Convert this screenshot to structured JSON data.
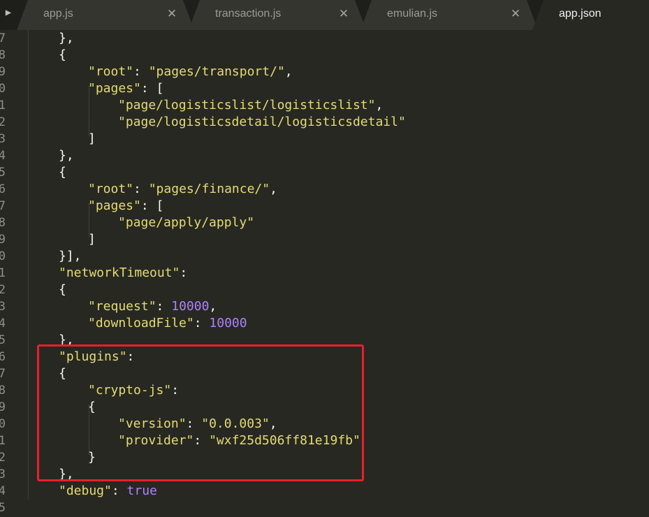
{
  "tabs": [
    {
      "label": "app.js",
      "active": false
    },
    {
      "label": "transaction.js",
      "active": false
    },
    {
      "label": "emulian.js",
      "active": false
    },
    {
      "label": "app.json",
      "active": true
    }
  ],
  "tab_close_glyph": "✕",
  "gutter_numbers": [
    "7",
    "8",
    "9",
    "0",
    "1",
    "2",
    "3",
    "4",
    "5",
    "6",
    "7",
    "8",
    "9",
    "0",
    "1",
    "2",
    "3",
    "4",
    "5",
    "6",
    "7",
    "8",
    "9",
    "0",
    "1",
    "2",
    "3",
    "4",
    "5"
  ],
  "code_lines": [
    [
      {
        "t": "},",
        "k": "punct"
      }
    ],
    [
      {
        "t": "{",
        "k": "punct"
      }
    ],
    [
      {
        "t": "\"root\"",
        "k": "key"
      },
      {
        "t": ": ",
        "k": "punct"
      },
      {
        "t": "\"pages/transport/\"",
        "k": "str"
      },
      {
        "t": ",",
        "k": "punct"
      }
    ],
    [
      {
        "t": "\"pages\"",
        "k": "key"
      },
      {
        "t": ": [",
        "k": "punct"
      }
    ],
    [
      {
        "t": "\"page/logisticslist/logisticslist\"",
        "k": "str"
      },
      {
        "t": ",",
        "k": "punct"
      }
    ],
    [
      {
        "t": "\"page/logisticsdetail/logisticsdetail\"",
        "k": "str"
      }
    ],
    [
      {
        "t": "]",
        "k": "punct"
      }
    ],
    [
      {
        "t": "},",
        "k": "punct"
      }
    ],
    [
      {
        "t": "{",
        "k": "punct"
      }
    ],
    [
      {
        "t": "\"root\"",
        "k": "key"
      },
      {
        "t": ": ",
        "k": "punct"
      },
      {
        "t": "\"pages/finance/\"",
        "k": "str"
      },
      {
        "t": ",",
        "k": "punct"
      }
    ],
    [
      {
        "t": "\"pages\"",
        "k": "key"
      },
      {
        "t": ": [",
        "k": "punct"
      }
    ],
    [
      {
        "t": "\"page/apply/apply\"",
        "k": "str"
      }
    ],
    [
      {
        "t": "]",
        "k": "punct"
      }
    ],
    [
      {
        "t": "}],",
        "k": "punct"
      }
    ],
    [
      {
        "t": "\"networkTimeout\"",
        "k": "key"
      },
      {
        "t": ":",
        "k": "punct"
      }
    ],
    [
      {
        "t": "{",
        "k": "punct"
      }
    ],
    [
      {
        "t": "\"request\"",
        "k": "key"
      },
      {
        "t": ": ",
        "k": "punct"
      },
      {
        "t": "10000",
        "k": "num"
      },
      {
        "t": ",",
        "k": "punct"
      }
    ],
    [
      {
        "t": "\"downloadFile\"",
        "k": "key"
      },
      {
        "t": ": ",
        "k": "punct"
      },
      {
        "t": "10000",
        "k": "num"
      }
    ],
    [
      {
        "t": "},",
        "k": "punct"
      }
    ],
    [
      {
        "t": "\"plugins\"",
        "k": "key"
      },
      {
        "t": ":",
        "k": "punct"
      }
    ],
    [
      {
        "t": "{",
        "k": "punct"
      }
    ],
    [
      {
        "t": "\"crypto-js\"",
        "k": "key"
      },
      {
        "t": ":",
        "k": "punct"
      }
    ],
    [
      {
        "t": "{",
        "k": "punct"
      }
    ],
    [
      {
        "t": "\"version\"",
        "k": "key"
      },
      {
        "t": ": ",
        "k": "punct"
      },
      {
        "t": "\"0.0.003\"",
        "k": "str"
      },
      {
        "t": ",",
        "k": "punct"
      }
    ],
    [
      {
        "t": "\"provider\"",
        "k": "key"
      },
      {
        "t": ": ",
        "k": "punct"
      },
      {
        "t": "\"wxf25d506ff81e19fb\"",
        "k": "str"
      }
    ],
    [
      {
        "t": "}",
        "k": "punct"
      }
    ],
    [
      {
        "t": "},",
        "k": "punct"
      }
    ],
    [
      {
        "t": "\"debug\"",
        "k": "key"
      },
      {
        "t": ": ",
        "k": "punct"
      },
      {
        "t": "true",
        "k": "bool"
      }
    ],
    []
  ],
  "colors": {
    "background": "#272822",
    "highlight_box": "#e8202a",
    "string": "#e6db74",
    "number": "#ae81ff"
  }
}
